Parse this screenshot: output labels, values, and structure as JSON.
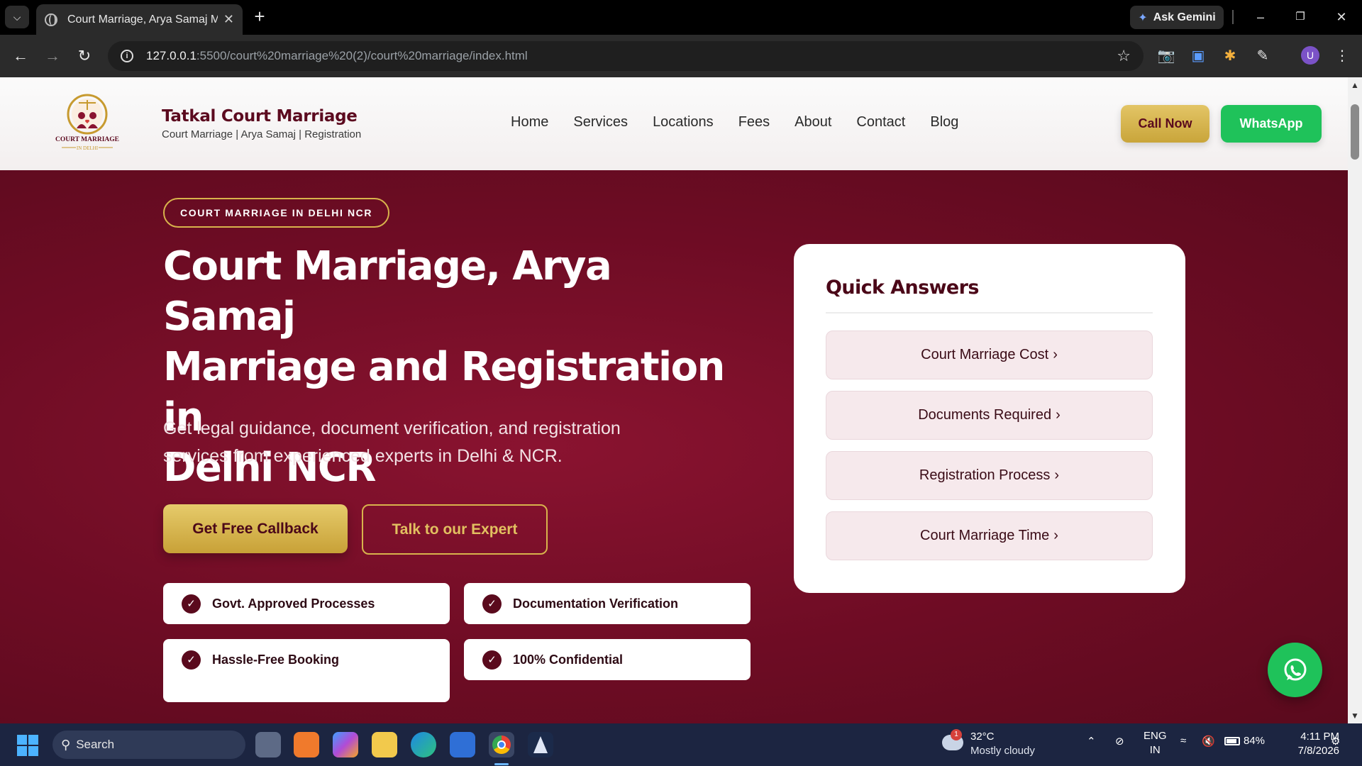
{
  "browser": {
    "tab_title": "Court Marriage, Arya Samaj Ma",
    "ask_gemini": "Ask Gemini",
    "url_host": "127.0.0.1",
    "url_path": ":5500/court%20marriage%20(2)/court%20marriage/index.html",
    "profile_initial": "U"
  },
  "site": {
    "brand_name": "Tatkal Court Marriage",
    "brand_tagline": "Court Marriage | Arya Samaj | Registration",
    "logo_text_1": "COURT MARRIAGE",
    "logo_text_2": "IN DELHI",
    "nav": [
      "Home",
      "Services",
      "Locations",
      "Fees",
      "About",
      "Contact",
      "Blog"
    ],
    "call_now": "Call Now",
    "whatsapp": "WhatsApp"
  },
  "hero": {
    "badge": "COURT MARRIAGE IN DELHI NCR",
    "heading_1": "Court Marriage, Arya Samaj",
    "heading_2": "Marriage and Registration in",
    "heading_3": "Delhi NCR",
    "subheading": "Get legal guidance, document verification, and registration services from experienced experts in Delhi & NCR.",
    "primary_cta": "Get Free Callback",
    "secondary_cta": "Talk to our Expert",
    "features": [
      "Govt. Approved Processes",
      "Documentation Verification",
      "Hassle-Free Booking",
      "100% Confidential"
    ]
  },
  "quick_answers": {
    "title": "Quick Answers",
    "items": [
      "Court Marriage Cost",
      "Documents Required",
      "Registration Process",
      "Court Marriage Time"
    ]
  },
  "taskbar": {
    "search_label": "Search",
    "weather_temp": "32°C",
    "weather_desc": "Mostly cloudy",
    "weather_badge": "1",
    "lang_1": "ENG",
    "lang_2": "IN",
    "battery": "84%",
    "time": "4:11 PM",
    "date": "7/8/2026"
  },
  "colors": {
    "maroon": "#6f0d24",
    "gold": "#d8b34c",
    "whatsapp_green": "#1fc25a"
  }
}
